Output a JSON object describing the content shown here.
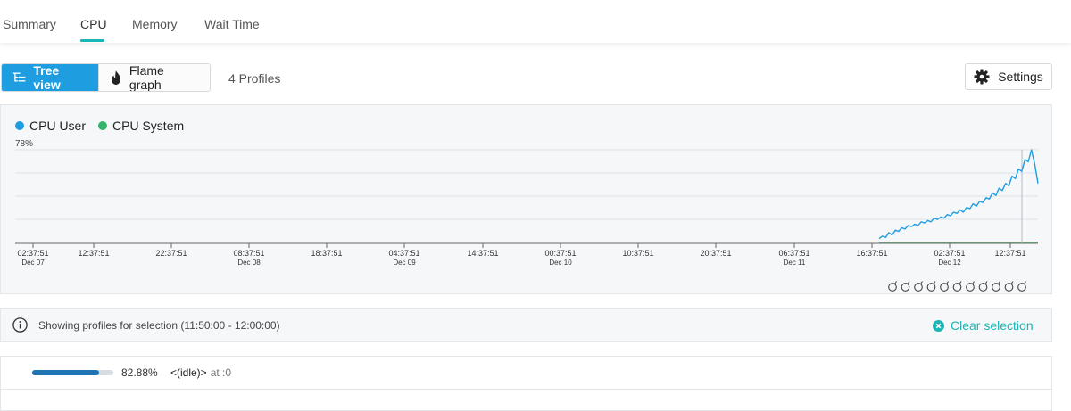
{
  "tabs": [
    {
      "label": "Summary",
      "active": false
    },
    {
      "label": "CPU",
      "active": true
    },
    {
      "label": "Memory",
      "active": false
    },
    {
      "label": "Wait Time",
      "active": false
    }
  ],
  "toolbar": {
    "tree_view_label": "Tree view",
    "flame_graph_label": "Flame graph",
    "profiles_count": "4 Profiles",
    "settings_label": "Settings",
    "tree_icon": "tree-icon",
    "flame_icon": "flame-icon",
    "gear_icon": "gear-icon"
  },
  "chart": {
    "legend": [
      {
        "label": "CPU User",
        "color": "#1e9ee0"
      },
      {
        "label": "CPU System",
        "color": "#35b36b"
      }
    ],
    "max_label": "78%",
    "x_ticks": [
      {
        "time": "02:37:51",
        "date": "Dec 07"
      },
      {
        "time": "12:37:51",
        "date": ""
      },
      {
        "time": "22:37:51",
        "date": ""
      },
      {
        "time": "08:37:51",
        "date": "Dec 08"
      },
      {
        "time": "18:37:51",
        "date": ""
      },
      {
        "time": "04:37:51",
        "date": "Dec 09"
      },
      {
        "time": "14:37:51",
        "date": ""
      },
      {
        "time": "00:37:51",
        "date": "Dec 10"
      },
      {
        "time": "10:37:51",
        "date": ""
      },
      {
        "time": "20:37:51",
        "date": ""
      },
      {
        "time": "06:37:51",
        "date": "Dec 11"
      },
      {
        "time": "16:37:51",
        "date": ""
      },
      {
        "time": "02:37:51",
        "date": "Dec 12"
      },
      {
        "time": "12:37:51",
        "date": ""
      }
    ],
    "deploy_markers_count": 11,
    "deploy_icon": "deploy-marker-icon"
  },
  "chart_data": {
    "type": "line",
    "series": [
      {
        "name": "CPU User",
        "color": "#1e9ee0",
        "values": [
          4,
          6,
          5,
          9,
          7,
          11,
          10,
          13,
          12,
          15,
          14,
          16,
          15,
          18,
          17,
          19,
          18,
          21,
          20,
          22,
          21,
          24,
          23,
          26,
          25,
          28,
          26,
          30,
          29,
          33,
          31,
          35,
          34,
          38,
          37,
          42,
          40,
          46,
          44,
          50,
          48,
          56,
          54,
          62,
          60,
          70,
          68,
          78,
          66,
          50
        ]
      },
      {
        "name": "CPU System",
        "color": "#35b36b",
        "values": [
          1,
          1,
          1,
          1,
          1,
          1,
          1,
          1,
          1,
          1,
          1,
          1,
          1,
          1,
          1,
          1,
          1,
          1,
          1,
          1,
          1,
          1,
          1,
          1,
          1,
          1,
          1,
          1,
          1,
          1,
          1,
          1,
          1,
          1,
          1,
          1,
          1,
          1,
          1,
          1,
          1,
          1,
          1,
          1,
          1,
          1,
          1,
          1,
          1,
          1
        ]
      }
    ],
    "x_start": "16:37:51 Dec 11",
    "x_end": "12:37:51 Dec 12",
    "ylim": [
      0,
      78
    ],
    "ytick_label": "78%",
    "grid": true,
    "legend_position": "top-left"
  },
  "selection": {
    "text": "Showing profiles for selection (11:50:00 - 12:00:00)",
    "clear_label": "Clear selection",
    "info_icon": "info-icon",
    "clear_icon": "clear-icon"
  },
  "profile_rows": [
    {
      "percent": "82.88%",
      "percent_value": 82.88,
      "name": "<(idle)>",
      "location": "at :0"
    }
  ]
}
